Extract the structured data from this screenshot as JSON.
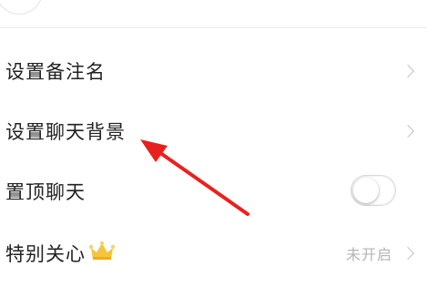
{
  "settings": {
    "items": [
      {
        "label": "设置备注名"
      },
      {
        "label": "设置聊天背景"
      },
      {
        "label": "置顶聊天",
        "toggle_on": false
      },
      {
        "label": "特别关心",
        "status": "未开启"
      }
    ]
  },
  "colors": {
    "annotation_arrow": "#e8211f",
    "crown": "#f7c53b"
  }
}
